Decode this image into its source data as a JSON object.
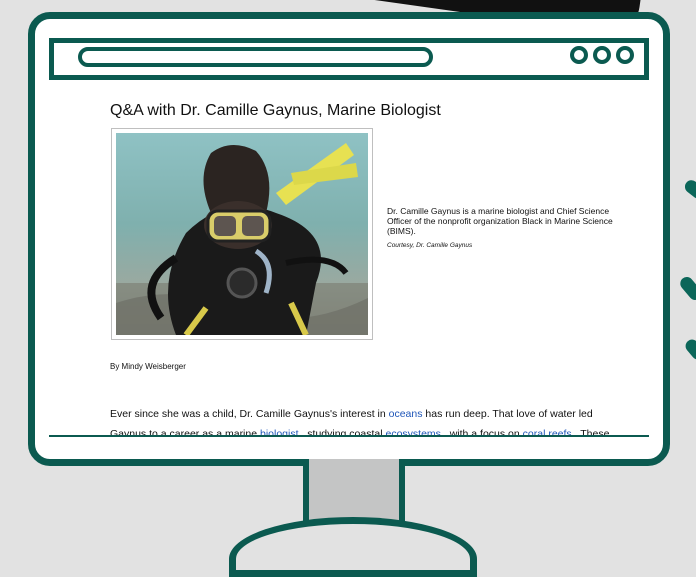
{
  "browser": {
    "url": ""
  },
  "article": {
    "title": "Q&A with Dr. Camille Gaynus, Marine Biologist",
    "caption": "Dr. Camille Gaynus is a marine biologist and Chief Science Officer of the nonprofit organization Black in Marine Science (BIMS).",
    "credit": "Courtesy, Dr. Camille Gaynus",
    "byline": "By Mindy Weisberger",
    "body": {
      "p1": "Ever since she was a child, Dr. Camille Gaynus's interest in ",
      "link_oceans": "oceans",
      "p2": " has run deep. That love of water led Gaynus to a career as a marine ",
      "link_biologist": "biologist",
      "p3": " , studying coastal ",
      "link_ecosystems": "ecosystems",
      "p4": " , with a focus on ",
      "link_coral_reefs": "coral reefs",
      "p5": " . These"
    }
  },
  "colors": {
    "frame": "#0b5a50",
    "link": "#1f56b8",
    "accent": "#0b6659"
  }
}
